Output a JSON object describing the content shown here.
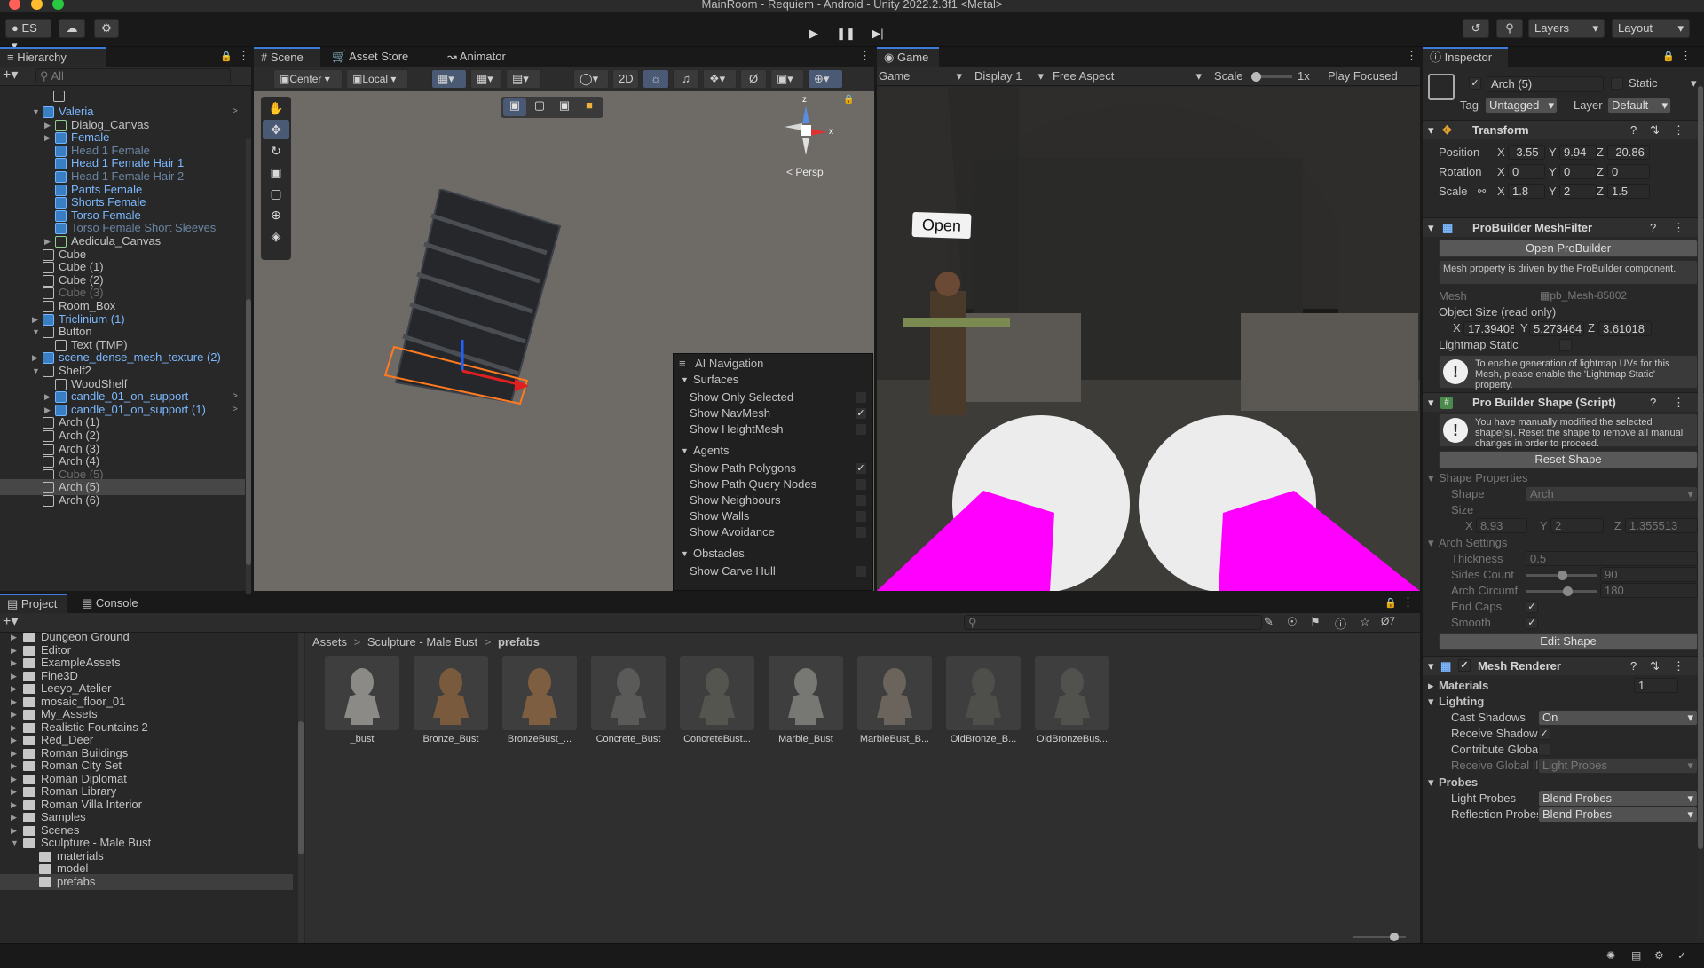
{
  "window": {
    "title": "MainRoom - Requiem - Android - Unity 2022.2.3f1 <Metal>"
  },
  "toolbar": {
    "account_label": "ES",
    "layers_label": "Layers",
    "layout_label": "Layout",
    "play_icon": "play-icon",
    "pause_icon": "pause-icon",
    "step_icon": "step-icon"
  },
  "hierarchy": {
    "tab": "Hierarchy",
    "search_placeholder": "All",
    "items": [
      {
        "label": "Valeria",
        "indent": 0,
        "style": "prefab",
        "arrow": "down",
        "icon": "blue"
      },
      {
        "label": "Dialog_Canvas",
        "indent": 1,
        "style": "normal",
        "arrow": "right",
        "icon": "green"
      },
      {
        "label": "Female",
        "indent": 1,
        "style": "prefab",
        "arrow": "right",
        "icon": "blue"
      },
      {
        "label": "Head 1 Female",
        "indent": 1,
        "style": "dim",
        "arrow": "",
        "icon": "blue"
      },
      {
        "label": "Head 1 Female Hair 1",
        "indent": 1,
        "style": "prefab",
        "arrow": "",
        "icon": "blue"
      },
      {
        "label": "Head 1 Female Hair 2",
        "indent": 1,
        "style": "dim",
        "arrow": "",
        "icon": "blue"
      },
      {
        "label": "Pants Female",
        "indent": 1,
        "style": "prefab",
        "arrow": "",
        "icon": "blue"
      },
      {
        "label": "Shorts Female",
        "indent": 1,
        "style": "prefab",
        "arrow": "",
        "icon": "blue"
      },
      {
        "label": "Torso Female",
        "indent": 1,
        "style": "prefab",
        "arrow": "",
        "icon": "blue"
      },
      {
        "label": "Torso Female Short Sleeves",
        "indent": 1,
        "style": "dim",
        "arrow": "",
        "icon": "blue"
      },
      {
        "label": "Aedicula_Canvas",
        "indent": 1,
        "style": "normal",
        "arrow": "right",
        "icon": "green"
      },
      {
        "label": "Cube",
        "indent": 0,
        "style": "normal",
        "arrow": "",
        "icon": "gray"
      },
      {
        "label": "Cube (1)",
        "indent": 0,
        "style": "normal",
        "arrow": "",
        "icon": "gray"
      },
      {
        "label": "Cube (2)",
        "indent": 0,
        "style": "normal",
        "arrow": "",
        "icon": "gray"
      },
      {
        "label": "Cube (3)",
        "indent": 0,
        "style": "gray",
        "arrow": "",
        "icon": "gray"
      },
      {
        "label": "Room_Box",
        "indent": 0,
        "style": "normal",
        "arrow": "",
        "icon": "gray"
      },
      {
        "label": "Triclinium (1)",
        "indent": 0,
        "style": "prefab",
        "arrow": "right",
        "icon": "blue"
      },
      {
        "label": "Button",
        "indent": 0,
        "style": "normal",
        "arrow": "down",
        "icon": "gray"
      },
      {
        "label": "Text (TMP)",
        "indent": 1,
        "style": "normal",
        "arrow": "",
        "icon": "gray"
      },
      {
        "label": "scene_dense_mesh_texture (2)",
        "indent": 0,
        "style": "prefab",
        "arrow": "right",
        "icon": "blue"
      },
      {
        "label": "Shelf2",
        "indent": 0,
        "style": "normal",
        "arrow": "down",
        "icon": "gray"
      },
      {
        "label": "WoodShelf",
        "indent": 1,
        "style": "normal",
        "arrow": "",
        "icon": "gray"
      },
      {
        "label": "candle_01_on_support",
        "indent": 1,
        "style": "prefab",
        "arrow": "right",
        "icon": "blue"
      },
      {
        "label": "candle_01_on_support (1)",
        "indent": 1,
        "style": "prefab",
        "arrow": "right",
        "icon": "blue"
      },
      {
        "label": "Arch (1)",
        "indent": 0,
        "style": "normal",
        "arrow": "",
        "icon": "gray"
      },
      {
        "label": "Arch (2)",
        "indent": 0,
        "style": "normal",
        "arrow": "",
        "icon": "gray"
      },
      {
        "label": "Arch (3)",
        "indent": 0,
        "style": "normal",
        "arrow": "",
        "icon": "gray"
      },
      {
        "label": "Arch (4)",
        "indent": 0,
        "style": "normal",
        "arrow": "",
        "icon": "gray"
      },
      {
        "label": "Cube (5)",
        "indent": 0,
        "style": "gray",
        "arrow": "",
        "icon": "gray"
      },
      {
        "label": "Arch (5)",
        "indent": 0,
        "style": "sel",
        "arrow": "",
        "icon": "gray"
      },
      {
        "label": "Arch (6)",
        "indent": 0,
        "style": "normal",
        "arrow": "",
        "icon": "gray"
      }
    ]
  },
  "scene": {
    "tabs": [
      "Scene",
      "Asset Store",
      "Animator"
    ],
    "pivot_label": "Center",
    "space_label": "Local",
    "mode_2d": "2D",
    "persp_label": "< Persp",
    "gizmo_y": "z",
    "gizmo_x": "x",
    "ai_nav": {
      "title": "AI Navigation",
      "sections": [
        {
          "header": "Surfaces",
          "items": [
            {
              "label": "Show Only Selected",
              "checked": false
            },
            {
              "label": "Show NavMesh",
              "checked": true
            },
            {
              "label": "Show HeightMesh",
              "checked": false
            }
          ]
        },
        {
          "header": "Agents",
          "items": [
            {
              "label": "Show Path Polygons",
              "checked": true
            },
            {
              "label": "Show Path Query Nodes",
              "checked": false
            },
            {
              "label": "Show Neighbours",
              "checked": false
            },
            {
              "label": "Show Walls",
              "checked": false
            },
            {
              "label": "Show Avoidance",
              "checked": false
            }
          ]
        },
        {
          "header": "Obstacles",
          "items": [
            {
              "label": "Show Carve Hull",
              "checked": false
            }
          ]
        }
      ]
    }
  },
  "game": {
    "tab": "Game",
    "mode": "Game",
    "display": "Display 1",
    "aspect": "Free Aspect",
    "scale_label": "Scale",
    "scale_value": "1x",
    "play_focused": "Play Focused",
    "sign_text": "Open"
  },
  "inspector": {
    "tab": "Inspector",
    "object_name": "Arch (5)",
    "static_label": "Static",
    "tag_label": "Tag",
    "tag_value": "Untagged",
    "layer_label": "Layer",
    "layer_value": "Default",
    "transform": {
      "title": "Transform",
      "rows": [
        {
          "label": "Position",
          "x": "-3.55",
          "y": "9.94",
          "z": "-20.86"
        },
        {
          "label": "Rotation",
          "x": "0",
          "y": "0",
          "z": "0"
        },
        {
          "label": "Scale",
          "x": "1.8",
          "y": "2",
          "z": "1.5"
        }
      ]
    },
    "meshfilter": {
      "title": "ProBuilder MeshFilter",
      "open_button": "Open ProBuilder",
      "note": "Mesh property is driven by the ProBuilder component.",
      "mesh_label": "Mesh",
      "mesh_value": "pb_Mesh-85802",
      "object_size_label": "Object Size (read only)",
      "size_x": "17.39408",
      "size_y": "5.273464",
      "size_z": "3.61018",
      "lightmap_label": "Lightmap Static",
      "lightmap_help": "To enable generation of lightmap UVs for this Mesh, please enable the 'Lightmap Static' property."
    },
    "shape": {
      "title": "Pro Builder Shape (Script)",
      "help": "You have manually modified the selected shape(s). Reset the shape to remove all manual changes in order to proceed.",
      "reset_button": "Reset Shape",
      "props_header": "Shape Properties",
      "shape_label": "Shape",
      "shape_value": "Arch",
      "size_label": "Size",
      "size_x": "8.93",
      "size_y": "2",
      "size_z": "1.355513",
      "arch_header": "Arch Settings",
      "thickness_label": "Thickness",
      "thickness_value": "0.5",
      "sides_label": "Sides Count",
      "sides_value": "90",
      "circ_label": "Arch Circumf",
      "circ_value": "180",
      "endcaps_label": "End Caps",
      "smooth_label": "Smooth",
      "edit_button": "Edit Shape"
    },
    "renderer": {
      "title": "Mesh Renderer",
      "materials_label": "Materials",
      "materials_count": "1",
      "lighting_label": "Lighting",
      "cast_label": "Cast Shadows",
      "cast_value": "On",
      "receive_label": "Receive Shadows",
      "contrib_label": "Contribute Global I",
      "receive_gi_label": "Receive Global Illu",
      "receive_gi_value": "Light Probes",
      "probes_label": "Probes",
      "light_probes_label": "Light Probes",
      "light_probes_value": "Blend Probes",
      "refl_label": "Reflection Probes",
      "refl_value": "Blend Probes"
    }
  },
  "project": {
    "tabs": [
      "Project",
      "Console"
    ],
    "hidden_count": "7",
    "breadcrumb": [
      "Assets",
      "Sculpture - Male Bust",
      "prefabs"
    ],
    "folders": [
      {
        "label": "Dungeon Ground",
        "indent": 0
      },
      {
        "label": "Editor",
        "indent": 0
      },
      {
        "label": "ExampleAssets",
        "indent": 0
      },
      {
        "label": "Fine3D",
        "indent": 0
      },
      {
        "label": "Leeyo_Atelier",
        "indent": 0
      },
      {
        "label": "mosaic_floor_01",
        "indent": 0
      },
      {
        "label": "My_Assets",
        "indent": 0
      },
      {
        "label": "Realistic Fountains 2",
        "indent": 0
      },
      {
        "label": "Red_Deer",
        "indent": 0
      },
      {
        "label": "Roman Buildings",
        "indent": 0
      },
      {
        "label": "Roman City Set",
        "indent": 0
      },
      {
        "label": "Roman Diplomat",
        "indent": 0
      },
      {
        "label": "Roman Library",
        "indent": 0
      },
      {
        "label": "Roman Villa Interior",
        "indent": 0
      },
      {
        "label": "Samples",
        "indent": 0
      },
      {
        "label": "Scenes",
        "indent": 0
      },
      {
        "label": "Sculpture - Male Bust",
        "indent": 0
      },
      {
        "label": "materials",
        "indent": 1
      },
      {
        "label": "model",
        "indent": 1
      },
      {
        "label": "prefabs",
        "indent": 1
      }
    ],
    "assets": [
      {
        "label": "_bust",
        "tone": "#8c8a86"
      },
      {
        "label": "Bronze_Bust",
        "tone": "#7a5a3c"
      },
      {
        "label": "BronzeBust_...",
        "tone": "#7e5e40"
      },
      {
        "label": "Concrete_Bust",
        "tone": "#5a5a58"
      },
      {
        "label": "ConcreteBust...",
        "tone": "#55554f"
      },
      {
        "label": "Marble_Bust",
        "tone": "#777773"
      },
      {
        "label": "MarbleBust_B...",
        "tone": "#6a645c"
      },
      {
        "label": "OldBronze_B...",
        "tone": "#4e4f4a"
      },
      {
        "label": "OldBronzeBus...",
        "tone": "#51524e"
      }
    ]
  },
  "colors": {
    "accent": "#3d7bdc",
    "prefab": "#7cb8ff",
    "magenta": "#ff00ff",
    "panel": "#282828"
  }
}
